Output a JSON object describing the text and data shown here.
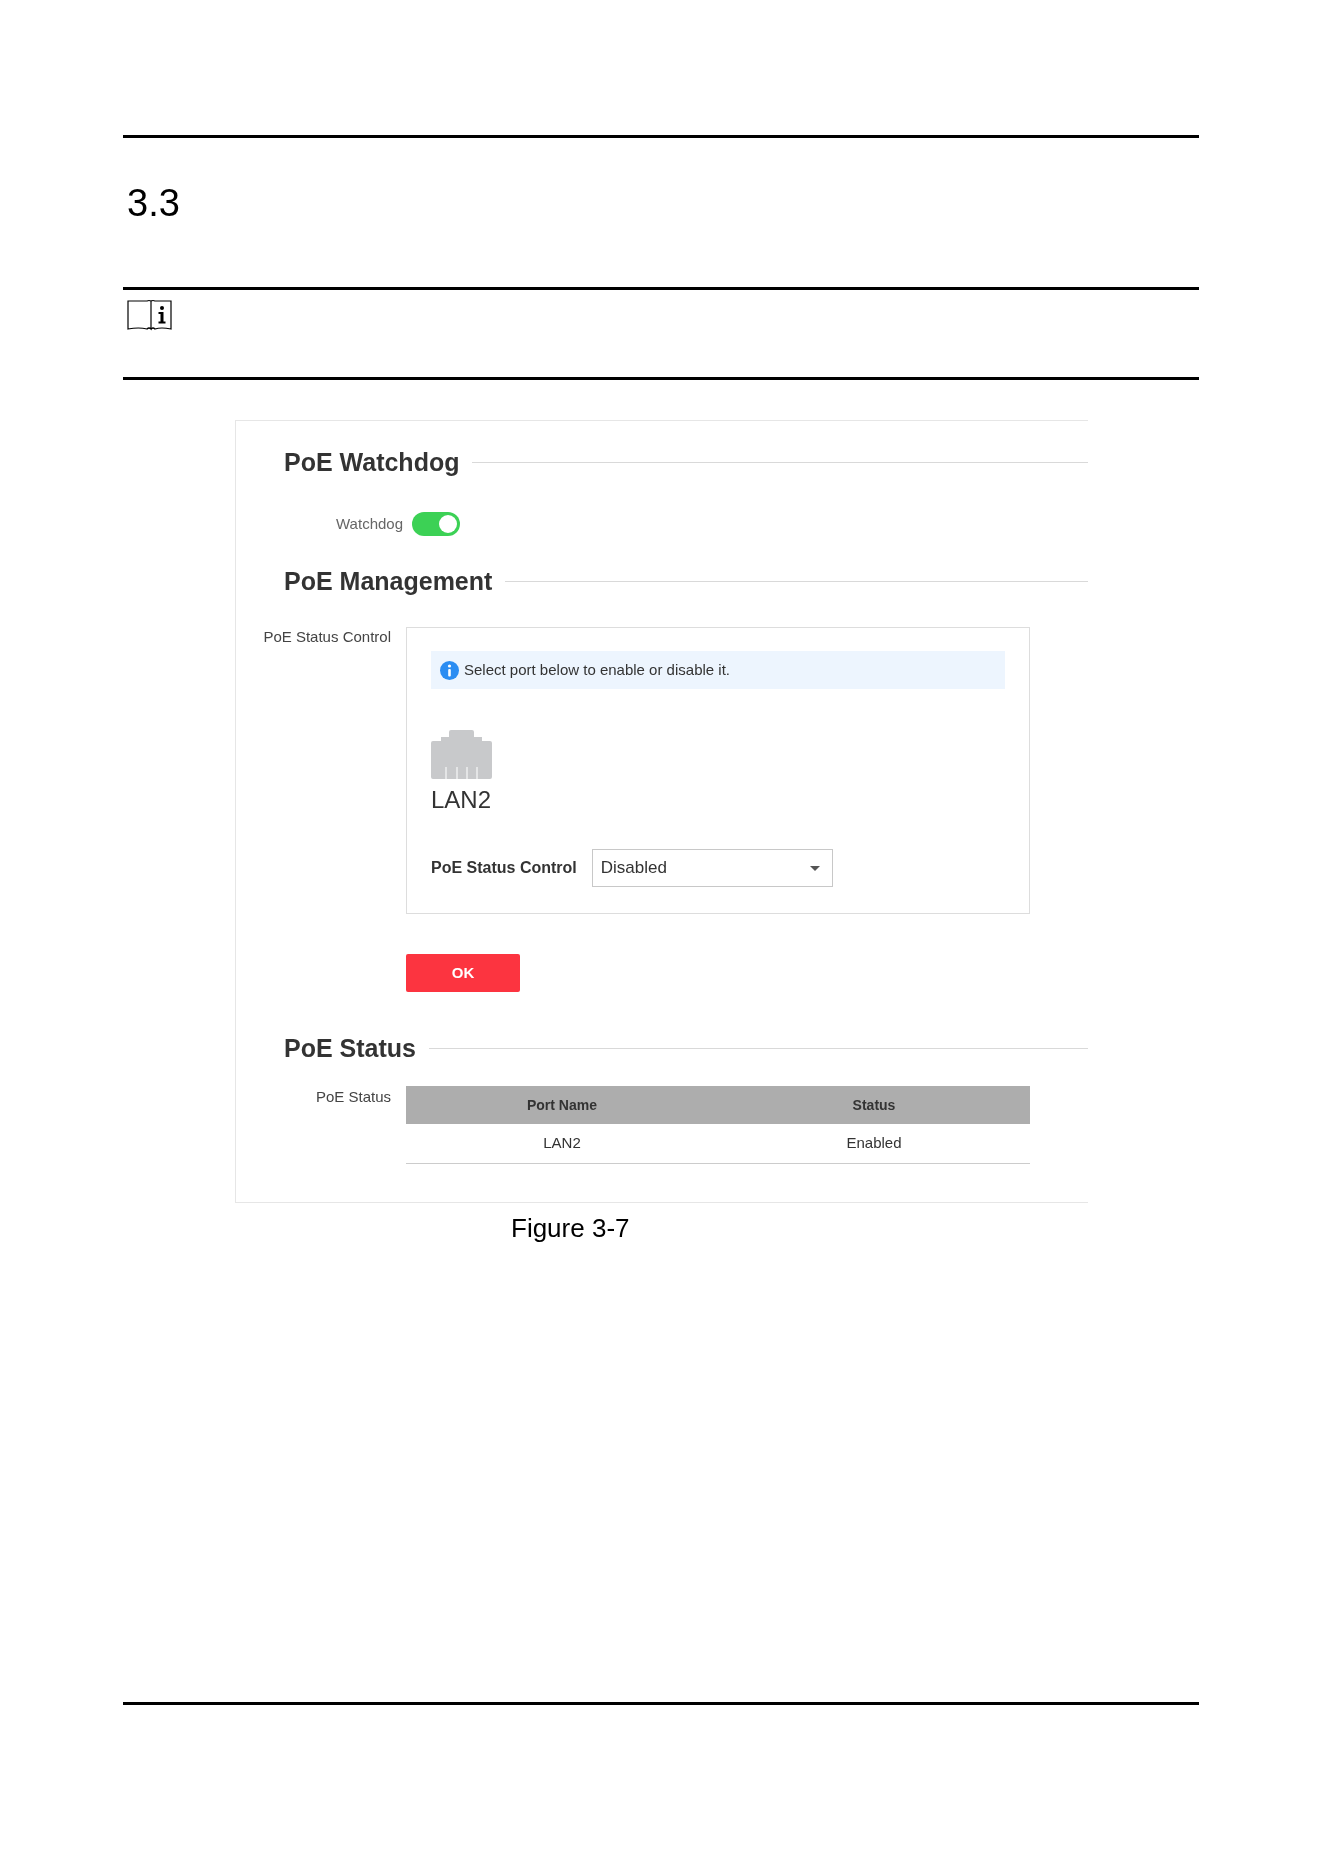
{
  "section_number": "3.3",
  "watchdog": {
    "title": "PoE Watchdog",
    "label": "Watchdog",
    "on": true
  },
  "management": {
    "title": "PoE Management",
    "label": "PoE Status Control",
    "info": "Select port below to enable or disable it.",
    "ports": [
      {
        "name": "LAN2",
        "selected": false
      }
    ],
    "control_label": "PoE Status Control",
    "control_value": "Disabled",
    "ok_button": "OK"
  },
  "status": {
    "title": "PoE Status",
    "label": "PoE Status",
    "table": {
      "columns": [
        "Port Name",
        "Status"
      ],
      "rows": [
        [
          "LAN2",
          "Enabled"
        ]
      ]
    }
  },
  "figure_caption": "Figure 3-7"
}
